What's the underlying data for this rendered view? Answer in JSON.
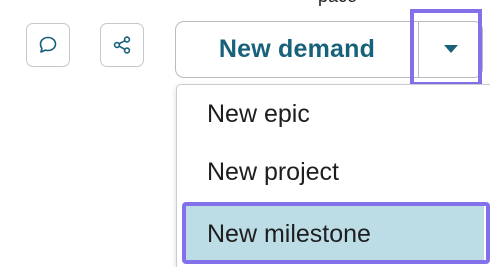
{
  "header": {
    "top_fragment": "pace",
    "comment_icon": "speech-bubble-icon",
    "share_icon": "share-icon"
  },
  "split_button": {
    "label": "New demand",
    "caret_icon": "caret-down-icon",
    "label_color": "#17627a"
  },
  "dropdown": {
    "items": [
      {
        "label": "New epic"
      },
      {
        "label": "New project"
      },
      {
        "label": "New milestone",
        "highlighted": true
      }
    ]
  },
  "colors": {
    "focus_outline": "#8371ec",
    "selected_item_bg": "#bcdde6"
  }
}
